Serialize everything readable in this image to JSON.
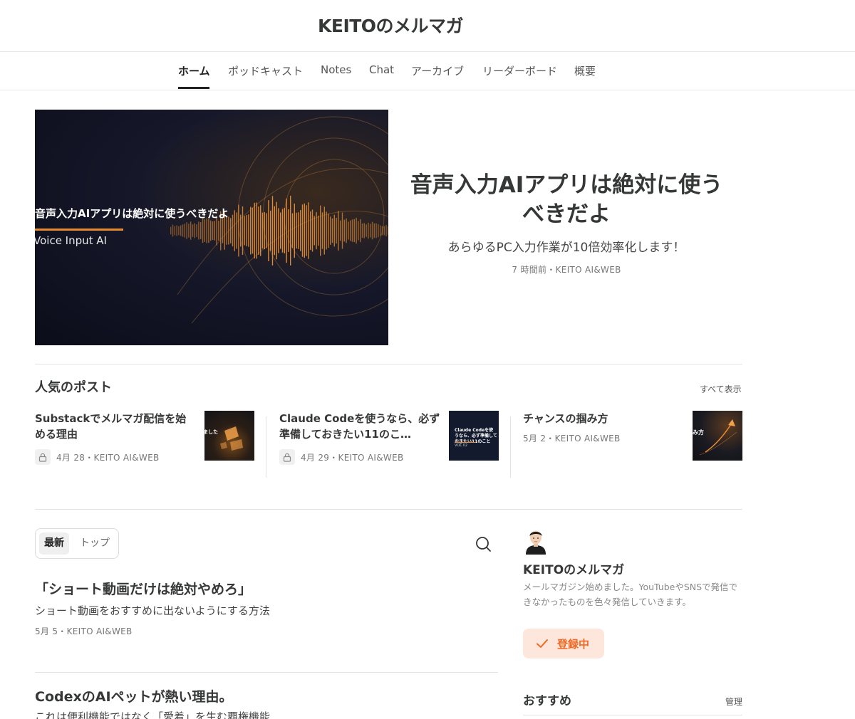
{
  "site": {
    "title": "KEITOのメルマガ"
  },
  "nav": {
    "tabs": [
      "ホーム",
      "ポッドキャスト",
      "Notes",
      "Chat",
      "アーカイブ",
      "リーダーボード",
      "概要"
    ]
  },
  "hero": {
    "image_title": "音声入力AIアプリは絶対に使うべきだよ",
    "image_subtitle": "Voice Input AI",
    "title": "音声入力AIアプリは絶対に使うべきだよ",
    "subtitle": "あらゆるPC入力作業が10倍効率化します！",
    "meta": "7 時間前・KEITO AI&WEB"
  },
  "popular": {
    "heading": "人気のポスト",
    "see_all": "すべて表示",
    "posts": [
      {
        "title": "Substackでメルマガ配信を始める理由",
        "meta": "4月 28・KEITO AI&WEB",
        "locked": true,
        "thumb_text": "ました"
      },
      {
        "title": "Claude Codeを使うなら、必ず準備しておきたい11のこ…",
        "meta": "4月 29・KEITO AI&WEB",
        "locked": true,
        "thumb_text": "Claude Codeを使うなら、必ず準備しておきたい11のこと",
        "thumb_tag": "VOL.02"
      },
      {
        "title": "チャンスの掴み方",
        "meta": "5月 2・KEITO AI&WEB",
        "locked": false,
        "thumb_text": "み方"
      }
    ]
  },
  "feed": {
    "tabs": [
      "最新",
      "トップ"
    ],
    "posts": [
      {
        "title": "「ショート動画だけは絶対やめろ」",
        "subtitle": "ショート動画をおすすめに出ないようにする方法",
        "meta": "5月 5・KEITO AI&WEB"
      },
      {
        "title": "CodexのAIペットが熱い理由。",
        "subtitle": "これは便利機能ではなく「愛着」を生む覇権機能"
      }
    ]
  },
  "sidebar": {
    "name": "KEITOのメルマガ",
    "description": "メールマガジン始めました。YouTubeやSNSで発信できなかったものを色々発信していきます。",
    "subscribe_label": "登録中",
    "recommend_title": "おすすめ",
    "manage_label": "管理"
  },
  "colors": {
    "accent": "#ef6a24",
    "accent_bg": "#fde6dc",
    "hero_orange": "#e88a2e"
  }
}
